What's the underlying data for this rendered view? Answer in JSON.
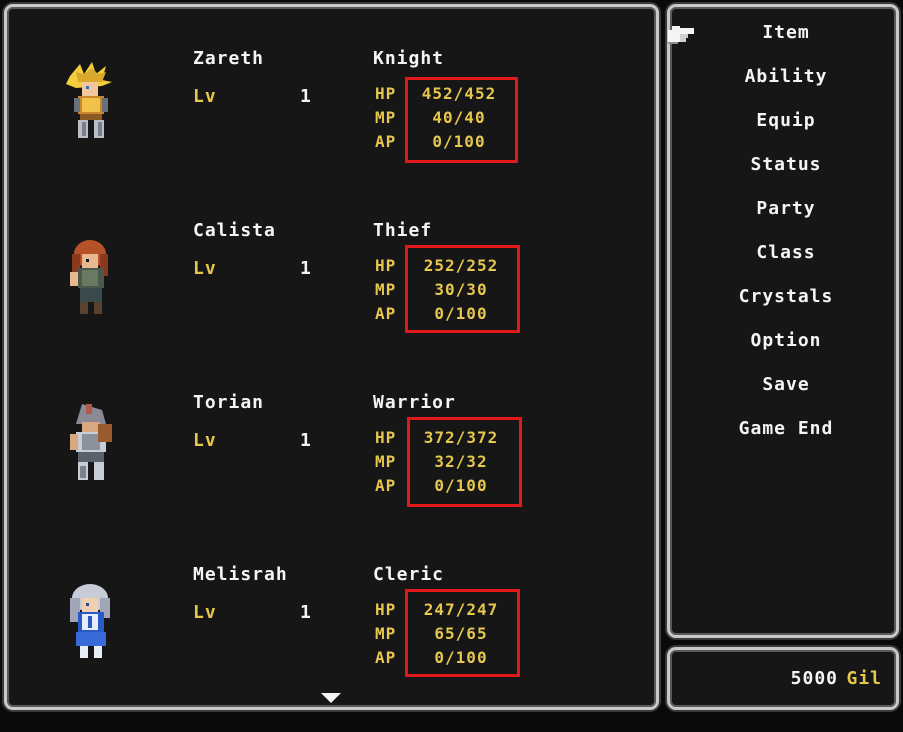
{
  "party": [
    {
      "name": "Zareth",
      "job": "Knight",
      "lv_label": "Lv",
      "lv": "1",
      "hp": "452/452",
      "mp": "40/40",
      "ap": "0/100"
    },
    {
      "name": "Calista",
      "job": "Thief",
      "lv_label": "Lv",
      "lv": "1",
      "hp": "252/252",
      "mp": "30/30",
      "ap": "0/100"
    },
    {
      "name": "Torian",
      "job": "Warrior",
      "lv_label": "Lv",
      "lv": "1",
      "hp": "372/372",
      "mp": "32/32",
      "ap": "0/100"
    },
    {
      "name": "Melisrah",
      "job": "Cleric",
      "lv_label": "Lv",
      "lv": "1",
      "hp": "247/247",
      "mp": "65/65",
      "ap": "0/100"
    }
  ],
  "stat_labels": {
    "hp": "HP",
    "mp": "MP",
    "ap": "AP"
  },
  "menu": {
    "items": [
      "Item",
      "Ability",
      "Equip",
      "Status",
      "Party",
      "Class",
      "Crystals",
      "Option",
      "Save",
      "Game End"
    ]
  },
  "gil": {
    "amount": "5000",
    "unit": "Gil"
  },
  "colors": {
    "label_yellow": "#e6c64c",
    "highlight_red": "#e0191a",
    "text_white": "#f4f4f4",
    "panel_bg": "#161616"
  }
}
